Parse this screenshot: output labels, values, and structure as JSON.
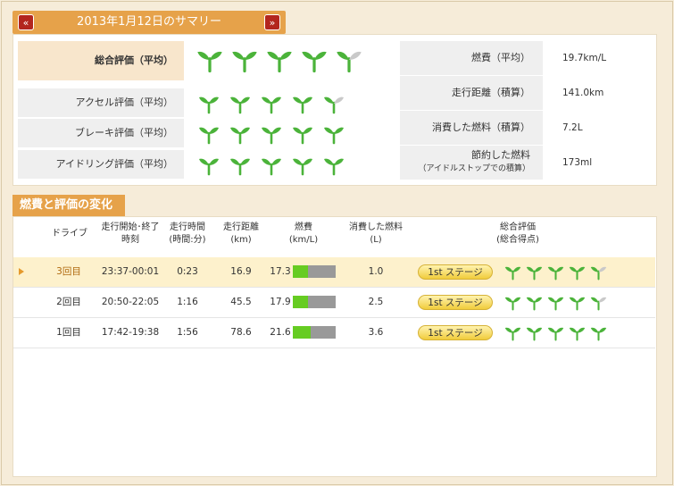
{
  "summary": {
    "title": "2013年1月12日のサマリー",
    "prev_icon": "chevron-double-left-icon",
    "next_icon": "chevron-double-right-icon",
    "ratings": [
      {
        "label": "総合評価（平均）",
        "score": 4.5
      },
      {
        "label": "アクセル評価（平均）",
        "score": 4.5
      },
      {
        "label": "ブレーキ評価（平均）",
        "score": 5
      },
      {
        "label": "アイドリング評価（平均）",
        "score": 5
      }
    ],
    "stats": [
      {
        "label": "燃費（平均）",
        "value": "19.7km/L"
      },
      {
        "label": "走行距離（積算）",
        "value": "141.0km"
      },
      {
        "label": "消費した燃料（積算）",
        "value": "7.2L"
      },
      {
        "label": "節約した燃料",
        "sublabel": "（アイドルストップでの積算）",
        "value": "173ml"
      }
    ]
  },
  "changes": {
    "title": "燃費と評価の変化",
    "headers": {
      "drive": "ドライブ",
      "time_range_1": "走行開始･終了",
      "time_range_2": "時刻",
      "duration_1": "走行時間",
      "duration_2": "(時間:分)",
      "distance_1": "走行距離",
      "distance_2": "(km)",
      "fuel_eff_1": "燃費",
      "fuel_eff_2": "(km/L)",
      "fuel_used_1": "消費した燃料",
      "fuel_used_2": "(L)",
      "rating_1": "総合評価",
      "rating_2": "(総合得点)"
    },
    "rows": [
      {
        "drive": "3回目",
        "time": "23:37-00:01",
        "duration": "0:23",
        "distance": "16.9",
        "efficiency": "17.3",
        "eff_fraction": 0.35,
        "fuel": "1.0",
        "stage": "1st ステージ",
        "score": 4.5,
        "selected": true
      },
      {
        "drive": "2回目",
        "time": "20:50-22:05",
        "duration": "1:16",
        "distance": "45.5",
        "efficiency": "17.9",
        "eff_fraction": 0.35,
        "fuel": "2.5",
        "stage": "1st ステージ",
        "score": 4.5,
        "selected": false
      },
      {
        "drive": "1回目",
        "time": "17:42-19:38",
        "duration": "1:56",
        "distance": "78.6",
        "efficiency": "21.6",
        "eff_fraction": 0.42,
        "fuel": "3.6",
        "stage": "1st ステージ",
        "score": 5,
        "selected": false
      }
    ]
  },
  "colors": {
    "accent": "#e6a24a",
    "sprout": "#4bb33a",
    "sprout_dim": "#c9c9c9",
    "bar_fill": "#66cc22"
  }
}
